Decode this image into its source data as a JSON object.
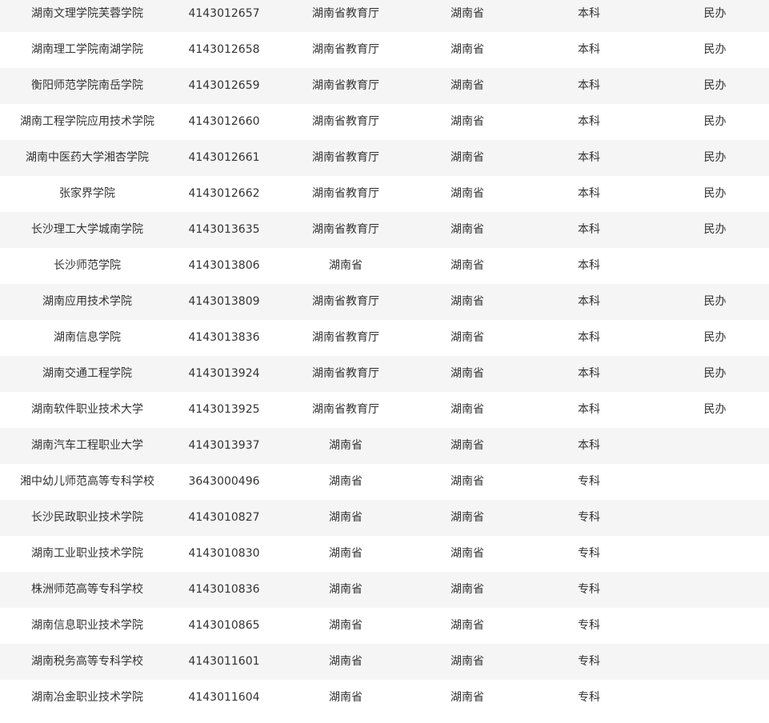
{
  "rows": [
    {
      "name": "湖南文理学院芙蓉学院",
      "code": "4143012657",
      "authority": "湖南省教育厅",
      "location": "湖南省",
      "level": "本科",
      "note": "民办"
    },
    {
      "name": "湖南理工学院南湖学院",
      "code": "4143012658",
      "authority": "湖南省教育厅",
      "location": "湖南省",
      "level": "本科",
      "note": "民办"
    },
    {
      "name": "衡阳师范学院南岳学院",
      "code": "4143012659",
      "authority": "湖南省教育厅",
      "location": "湖南省",
      "level": "本科",
      "note": "民办"
    },
    {
      "name": "湖南工程学院应用技术学院",
      "code": "4143012660",
      "authority": "湖南省教育厅",
      "location": "湖南省",
      "level": "本科",
      "note": "民办"
    },
    {
      "name": "湖南中医药大学湘杏学院",
      "code": "4143012661",
      "authority": "湖南省教育厅",
      "location": "湖南省",
      "level": "本科",
      "note": "民办"
    },
    {
      "name": "张家界学院",
      "code": "4143012662",
      "authority": "湖南省教育厅",
      "location": "湖南省",
      "level": "本科",
      "note": "民办"
    },
    {
      "name": "长沙理工大学城南学院",
      "code": "4143013635",
      "authority": "湖南省教育厅",
      "location": "湖南省",
      "level": "本科",
      "note": "民办"
    },
    {
      "name": "长沙师范学院",
      "code": "4143013806",
      "authority": "湖南省",
      "location": "湖南省",
      "level": "本科",
      "note": ""
    },
    {
      "name": "湖南应用技术学院",
      "code": "4143013809",
      "authority": "湖南省教育厅",
      "location": "湖南省",
      "level": "本科",
      "note": "民办"
    },
    {
      "name": "湖南信息学院",
      "code": "4143013836",
      "authority": "湖南省教育厅",
      "location": "湖南省",
      "level": "本科",
      "note": "民办"
    },
    {
      "name": "湖南交通工程学院",
      "code": "4143013924",
      "authority": "湖南省教育厅",
      "location": "湖南省",
      "level": "本科",
      "note": "民办"
    },
    {
      "name": "湖南软件职业技术大学",
      "code": "4143013925",
      "authority": "湖南省教育厅",
      "location": "湖南省",
      "level": "本科",
      "note": "民办"
    },
    {
      "name": "湖南汽车工程职业大学",
      "code": "4143013937",
      "authority": "湖南省",
      "location": "湖南省",
      "level": "本科",
      "note": ""
    },
    {
      "name": "湘中幼儿师范高等专科学校",
      "code": "3643000496",
      "authority": "湖南省",
      "location": "湖南省",
      "level": "专科",
      "note": ""
    },
    {
      "name": "长沙民政职业技术学院",
      "code": "4143010827",
      "authority": "湖南省",
      "location": "湖南省",
      "level": "专科",
      "note": ""
    },
    {
      "name": "湖南工业职业技术学院",
      "code": "4143010830",
      "authority": "湖南省",
      "location": "湖南省",
      "level": "专科",
      "note": ""
    },
    {
      "name": "株洲师范高等专科学校",
      "code": "4143010836",
      "authority": "湖南省",
      "location": "湖南省",
      "level": "专科",
      "note": ""
    },
    {
      "name": "湖南信息职业技术学院",
      "code": "4143010865",
      "authority": "湖南省",
      "location": "湖南省",
      "level": "专科",
      "note": ""
    },
    {
      "name": "湖南税务高等专科学校",
      "code": "4143011601",
      "authority": "湖南省",
      "location": "湖南省",
      "level": "专科",
      "note": ""
    },
    {
      "name": "湖南冶金职业技术学院",
      "code": "4143011604",
      "authority": "湖南省",
      "location": "湖南省",
      "level": "专科",
      "note": ""
    }
  ]
}
